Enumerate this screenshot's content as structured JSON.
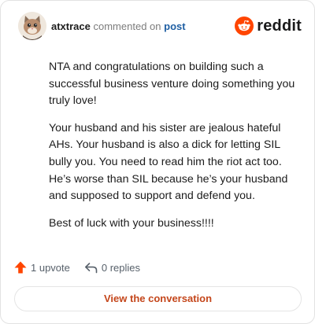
{
  "header": {
    "username": "atxtrace",
    "action_text": "commented on",
    "post_link": "post",
    "brand_name": "reddit",
    "avatar_icon": "cat-avatar-icon",
    "brand_icon": "reddit-snoo-icon"
  },
  "comment": {
    "paragraphs": [
      "NTA and congratulations on building such a successful business venture doing something you truly love!",
      "Your husband and his sister are jealous hateful AHs. Your husband is also a dick for letting SIL bully you. You need to read him the riot act too. He’s worse than SIL because he’s your husband and supposed to support and defend you.",
      "Best of luck with your business!!!!"
    ]
  },
  "actions": {
    "upvote_label": "1 upvote",
    "replies_label": "0 replies",
    "upvote_icon": "upvote-arrow-icon",
    "reply_icon": "reply-arrow-icon"
  },
  "cta": {
    "label": "View the conversation"
  },
  "colors": {
    "brand_orange": "#ff4500",
    "upvote_orange": "#ff4500",
    "link_blue": "#1f5fa3",
    "cta_text": "#c4461b",
    "text": "#1c1c1c",
    "muted": "#7c7c7c",
    "border": "#e2e2e2"
  }
}
